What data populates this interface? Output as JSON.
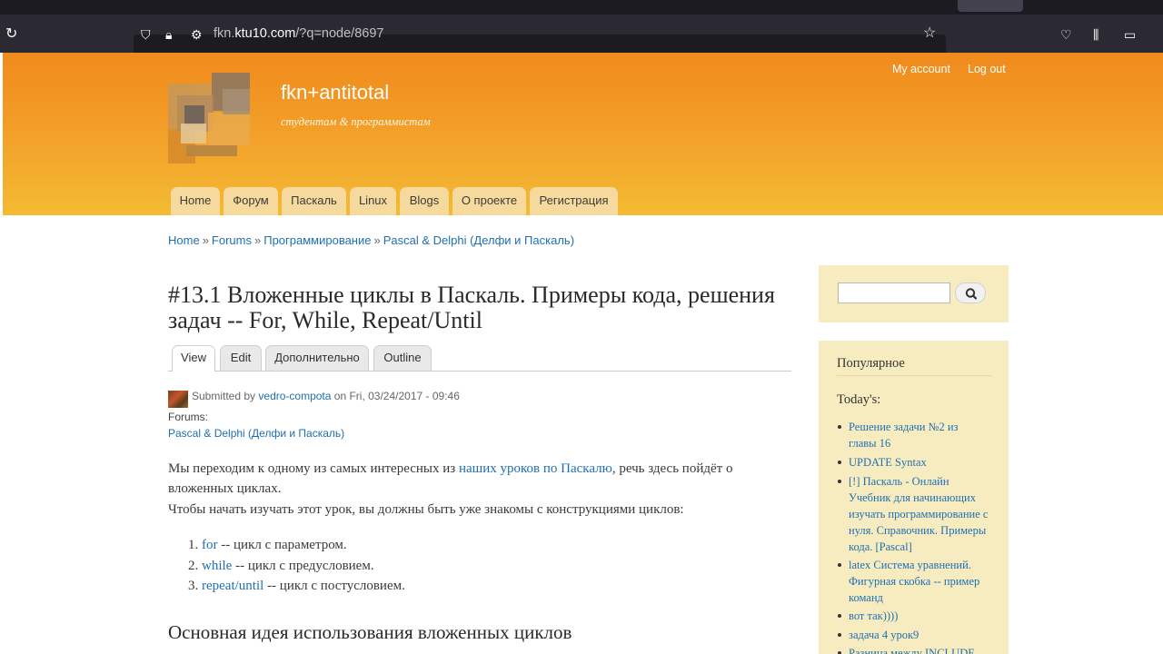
{
  "browser": {
    "url_prefix": "fkn.",
    "url_host": "ktu10.com",
    "url_path": "/?q=node/8697"
  },
  "site": {
    "name": "fkn+antitotal",
    "slogan": "студентам & программистам",
    "secondary_links": [
      "My account",
      "Log out"
    ],
    "primary_tabs": [
      "Home",
      "Форум",
      "Паскаль",
      "Linux",
      "Blogs",
      "О проекте",
      "Регистрация"
    ]
  },
  "breadcrumb": {
    "items": [
      "Home",
      "Forums",
      "Программирование",
      "Pascal & Delphi (Делфи и Паскаль)"
    ],
    "separator": "»"
  },
  "article": {
    "title": "#13.1 Вложенные циклы в Паскаль. Примеры кода, решения задач -- For, While, Repeat/Until",
    "local_tabs": [
      "View",
      "Edit",
      "Дополнительно",
      "Outline"
    ],
    "submitted_prefix": "Submitted by",
    "author": "vedro-compota",
    "submitted_suffix": "on Fri, 03/24/2017 - 09:46",
    "forums_label": "Forums:",
    "forum_link": "Pascal & Delphi (Делфи и Паскаль)",
    "para1_before": "Мы переходим к одному из самых интересных из",
    "para1_link": "наших уроков по Паскалю",
    "para1_after": ", речь здесь пойдёт о вложенных циклах.",
    "para2": "Чтобы начать изучать этот урок, вы должны быть уже знакомы с конструкциями циклов:",
    "loops": [
      {
        "num": "1.",
        "link": "for",
        "text": " -- цикл с параметром."
      },
      {
        "num": "2.",
        "link": "while",
        "text": " -- цикл с предусловием."
      },
      {
        "num": "3.",
        "link": "repeat/until",
        "text": " -- цикл с постусловием."
      }
    ],
    "subheading": "Основная идея использования вложенных циклов"
  },
  "sidebar": {
    "search_button_icon": "search-icon",
    "popular_title": "Популярное",
    "todays_label": "Today's:",
    "items": [
      "Решение задачи №2 из главы 16",
      "UPDATE Syntax",
      "[!] Паскаль - Онлайн Учебник для начинающих изучать программирование с нуля. Справочник. Примеры кода. [Pascal]",
      "latex Система уравнений. Фигурная скобка -- пример команд",
      "вот так))))",
      "задача 4 урок9",
      "Разница между INCLUDE"
    ]
  },
  "colors": {
    "header_top": "#f08a1c",
    "header_bottom": "#f3bb33",
    "link": "#1f6fb2",
    "sidebar_bg": "#f7ecc0"
  }
}
